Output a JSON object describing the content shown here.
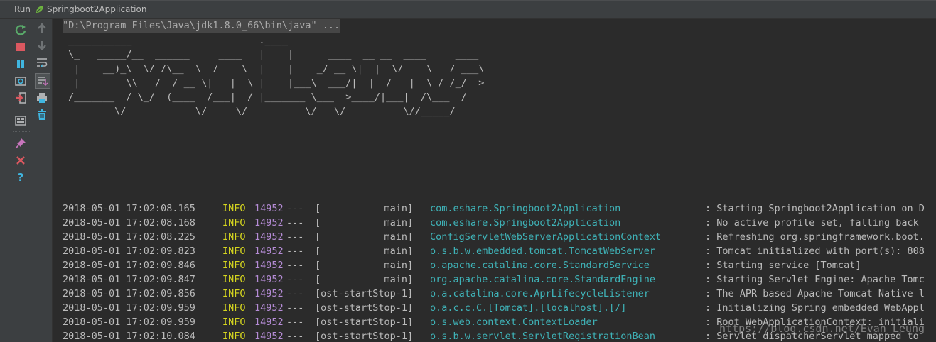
{
  "titlebar": {
    "run_label": "Run",
    "app_tab": "Springboot2Application"
  },
  "toolbar": {
    "left": [
      {
        "name": "rerun-icon",
        "color": "#59a869"
      },
      {
        "name": "stop-icon",
        "color": "#db5860"
      },
      {
        "name": "pause-icon",
        "color": "#40b6e0"
      },
      {
        "name": "dump-threads-icon",
        "color": "#afb1b3"
      },
      {
        "name": "exit-icon",
        "color": "#db5860"
      },
      {
        "name": "layout-icon",
        "color": "#afb1b3"
      },
      {
        "name": "pin-icon",
        "color": "#c775bc"
      },
      {
        "name": "close-icon",
        "color": "#db5860"
      },
      {
        "name": "help-icon",
        "color": "#40b6e0"
      }
    ],
    "right": [
      {
        "name": "scroll-up-icon",
        "color": "#6f7375"
      },
      {
        "name": "scroll-down-icon",
        "color": "#6f7375"
      },
      {
        "name": "soft-wrap-icon",
        "color": "#afb1b3"
      },
      {
        "name": "scroll-to-end-icon",
        "color": "#afb1b3"
      },
      {
        "name": "print-icon",
        "color": "#afb1b3"
      },
      {
        "name": "clear-icon",
        "color": "#40b6e0"
      }
    ]
  },
  "console": {
    "command": "\"D:\\Program Files\\Java\\jdk1.8.0_66\\bin\\java\" ...",
    "banner": [
      " ___________                      .____",
      " \\_   _____/__  ______     ____   |    |      ____  __ __  ____     ____",
      "  |    __)_\\  \\/ /\\__  \\  /    \\  |    |    _/ __ \\|  |  \\/    \\   / ___\\",
      "  |        \\\\   /  / __ \\|   |  \\ |    |___\\  ___/|  |  /   |  \\ / /_/  >",
      " /_______  / \\_/  (____  /___|  / |_______ \\___  >____/|___|  /\\___  /",
      "         \\/            \\/     \\/          \\/   \\/          \\//_____/"
    ],
    "logs": [
      {
        "ts": "2018-05-01 17:02:08.165",
        "level": "INFO",
        "pid": "14952",
        "sep": "---",
        "thread": "[           main]",
        "logger": "com.eshare.Springboot2Application",
        "msg": ": Starting Springboot2Application on D"
      },
      {
        "ts": "2018-05-01 17:02:08.168",
        "level": "INFO",
        "pid": "14952",
        "sep": "---",
        "thread": "[           main]",
        "logger": "com.eshare.Springboot2Application",
        "msg": ": No active profile set, falling back"
      },
      {
        "ts": "2018-05-01 17:02:08.225",
        "level": "INFO",
        "pid": "14952",
        "sep": "---",
        "thread": "[           main]",
        "logger": "ConfigServletWebServerApplicationContext",
        "msg": ": Refreshing org.springframework.boot."
      },
      {
        "ts": "2018-05-01 17:02:09.823",
        "level": "INFO",
        "pid": "14952",
        "sep": "---",
        "thread": "[           main]",
        "logger": "o.s.b.w.embedded.tomcat.TomcatWebServer",
        "msg": ": Tomcat initialized with port(s): 808"
      },
      {
        "ts": "2018-05-01 17:02:09.846",
        "level": "INFO",
        "pid": "14952",
        "sep": "---",
        "thread": "[           main]",
        "logger": "o.apache.catalina.core.StandardService",
        "msg": ": Starting service [Tomcat]"
      },
      {
        "ts": "2018-05-01 17:02:09.847",
        "level": "INFO",
        "pid": "14952",
        "sep": "---",
        "thread": "[           main]",
        "logger": "org.apache.catalina.core.StandardEngine",
        "msg": ": Starting Servlet Engine: Apache Tomc"
      },
      {
        "ts": "2018-05-01 17:02:09.856",
        "level": "INFO",
        "pid": "14952",
        "sep": "---",
        "thread": "[ost-startStop-1]",
        "logger": "o.a.catalina.core.AprLifecycleListener",
        "msg": ": The APR based Apache Tomcat Native l"
      },
      {
        "ts": "2018-05-01 17:02:09.959",
        "level": "INFO",
        "pid": "14952",
        "sep": "---",
        "thread": "[ost-startStop-1]",
        "logger": "o.a.c.c.C.[Tomcat].[localhost].[/]",
        "msg": ": Initializing Spring embedded WebAppl"
      },
      {
        "ts": "2018-05-01 17:02:09.959",
        "level": "INFO",
        "pid": "14952",
        "sep": "---",
        "thread": "[ost-startStop-1]",
        "logger": "o.s.web.context.ContextLoader",
        "msg": ": Root WebApplicationContext: initiali"
      },
      {
        "ts": "2018-05-01 17:02:10.084",
        "level": "INFO",
        "pid": "14952",
        "sep": "---",
        "thread": "[ost-startStop-1]",
        "logger": "o.s.b.w.servlet.ServletRegistrationBean",
        "msg": ": Servlet dispatcherServlet mapped to"
      }
    ],
    "watermark": "https://blog.csdn.net/Evan_Leung"
  },
  "colors": {
    "level": "#d6d61f",
    "pid": "#b58cd6",
    "logger": "#3fb3b8",
    "text": "#bbbbbb",
    "background": "#2b2b2b",
    "toolbar": "#3c3f41"
  }
}
